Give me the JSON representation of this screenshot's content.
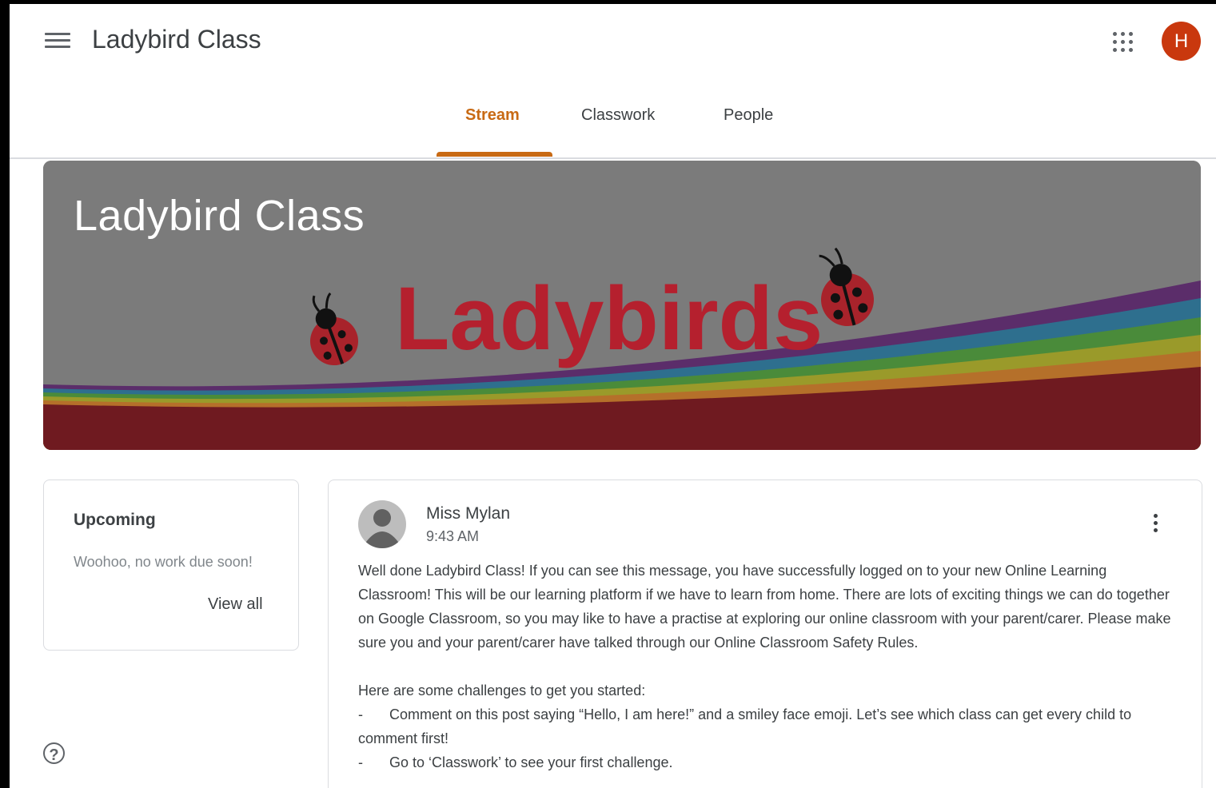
{
  "header": {
    "title": "Ladybird Class",
    "avatar_initial": "H"
  },
  "tabs": [
    {
      "label": "Stream",
      "active": true
    },
    {
      "label": "Classwork",
      "active": false
    },
    {
      "label": "People",
      "active": false
    }
  ],
  "banner": {
    "title": "Ladybird Class",
    "artwork_text": "Ladybirds"
  },
  "upcoming": {
    "title": "Upcoming",
    "empty_text": "Woohoo, no work due soon!",
    "view_all_label": "View all"
  },
  "post": {
    "author": "Miss Mylan",
    "time": "9:43 AM",
    "paragraph": "Well done Ladybird Class! If you can see this message, you have successfully logged on to your new Online Learning Classroom! This will be our learning platform if we have to learn from home. There are lots of exciting things we can do together on Google Classroom, so you may like to have a practise at exploring our online classroom with your parent/carer. Please make sure you and your parent/carer have talked through our Online Classroom Safety Rules.",
    "intro": "Here are some challenges to get you started:",
    "challenges": [
      "Comment on this post saying “Hello, I am here!” and a smiley face emoji. Let’s see which class can get every child to comment first!",
      "Go to ‘Classwork’ to see your first challenge."
    ],
    "bullet": "-"
  },
  "colors": {
    "accent": "#c86a14",
    "avatar": "#c9380e",
    "banner_gray": "#7b7b7b",
    "ladybird_red": "#b5202e"
  },
  "icons": [
    "menu-icon",
    "apps-grid-icon",
    "more-vert-icon",
    "help-icon",
    "person-icon",
    "ladybird-icon"
  ]
}
